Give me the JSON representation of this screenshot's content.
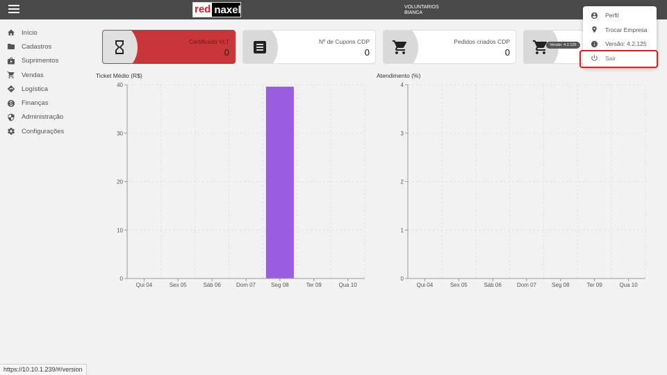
{
  "header": {
    "logo_red": "red",
    "logo_rest": "naxel",
    "company_line1": "VOLUNTARIOS",
    "company_line2": "BIANCA"
  },
  "sidebar": {
    "items": [
      {
        "label": "Início",
        "icon": "home-icon"
      },
      {
        "label": "Cadastros",
        "icon": "folder-icon"
      },
      {
        "label": "Suprimentos",
        "icon": "supplies-icon"
      },
      {
        "label": "Vendas",
        "icon": "cart-icon"
      },
      {
        "label": "Logística",
        "icon": "route-icon"
      },
      {
        "label": "Finanças",
        "icon": "dollar-icon"
      },
      {
        "label": "Administração",
        "icon": "shield-icon"
      },
      {
        "label": "Configurações",
        "icon": "gear-icon"
      }
    ]
  },
  "cards": [
    {
      "title": "Certificado VLT",
      "value": "0",
      "icon": "hourglass-icon",
      "color": "#c8363a"
    },
    {
      "title": "Nº de Cupons CDP",
      "value": "0",
      "icon": "receipt-icon"
    },
    {
      "title": "Pedidos criados CDP",
      "value": "0",
      "icon": "cart-icon"
    },
    {
      "title": "",
      "value": "",
      "icon": "cart-icon",
      "badge": "Versão: 4.2.125"
    }
  ],
  "dropdown": {
    "items": [
      {
        "label": "Perfil",
        "icon": "account-icon"
      },
      {
        "label": "Trocar Empresa",
        "icon": "location-icon"
      },
      {
        "label": "Versão: 4.2.125",
        "icon": "info-icon"
      },
      {
        "label": "Sair",
        "icon": "power-icon"
      }
    ]
  },
  "status_url": "https://10.10.1.239/#/version",
  "chart_data": [
    {
      "type": "bar",
      "title": "Ticket Médio (R$)",
      "categories": [
        "Qui 04",
        "Sex 05",
        "Sáb 06",
        "Dom 07",
        "Seg 08",
        "Ter 09",
        "Qua 10"
      ],
      "values": [
        0,
        0,
        0,
        0,
        39.6,
        0,
        0
      ],
      "ylim": [
        0,
        40
      ],
      "yticks": [
        0,
        10,
        20,
        30,
        40
      ],
      "bar_color": "#9b5de0",
      "grid": true
    },
    {
      "type": "bar",
      "title": "Atendimento (%)",
      "categories": [
        "Qui 04",
        "Sex 05",
        "Sáb 06",
        "Dom 07",
        "Seg 08",
        "Ter 09",
        "Qua 10"
      ],
      "values": [
        0,
        0,
        0,
        0,
        0,
        0,
        0
      ],
      "ylim": [
        0,
        4
      ],
      "yticks": [
        0,
        1,
        2,
        3,
        4
      ],
      "bar_color": "#9b5de0",
      "grid": true
    }
  ]
}
